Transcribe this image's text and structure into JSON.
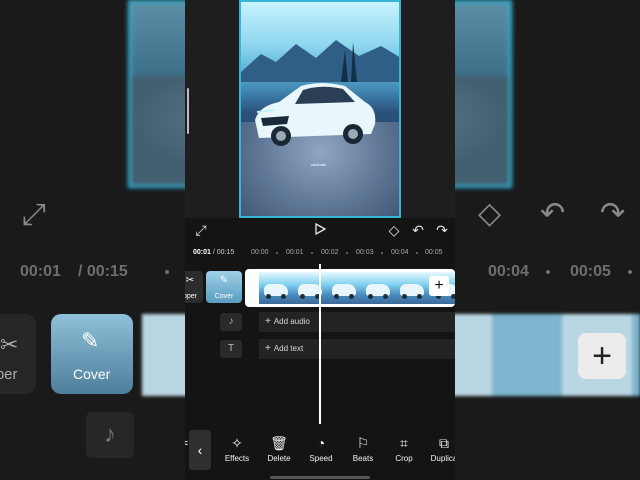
{
  "background": {
    "time_current": "00:01",
    "time_total": "/ 00:15",
    "ticks": [
      "00:04",
      "00:05"
    ],
    "tiles": [
      "Clipper",
      "Cover"
    ]
  },
  "preview": {
    "watermark": "carshots"
  },
  "controls": {
    "fullscreen_icon": "expand-icon",
    "play_icon": "play-icon",
    "keyframe_icon": "keyframe-icon",
    "undo_icon": "undo-icon",
    "redo_icon": "redo-icon"
  },
  "ruler": {
    "current": "00:01",
    "total": " / 00:15",
    "ticks": [
      "00:00",
      "00:01",
      "00:02",
      "00:03",
      "00:04",
      "00:05"
    ]
  },
  "timeline": {
    "clipper_label": "pper",
    "cover_label": "Cover",
    "add_audio": "Add audio",
    "add_text": "Add text"
  },
  "toolbar": {
    "items": [
      {
        "label": "s",
        "icon": "scissors-icon"
      },
      {
        "label": "Effects",
        "icon": "effects-icon"
      },
      {
        "label": "Delete",
        "icon": "trash-icon"
      },
      {
        "label": "Speed",
        "icon": "speed-icon"
      },
      {
        "label": "Beats",
        "icon": "flag-icon"
      },
      {
        "label": "Crop",
        "icon": "crop-icon"
      },
      {
        "label": "Duplica",
        "icon": "duplicate-icon"
      }
    ]
  },
  "colors": {
    "accent": "#35b6d9",
    "panel": "#141414"
  }
}
